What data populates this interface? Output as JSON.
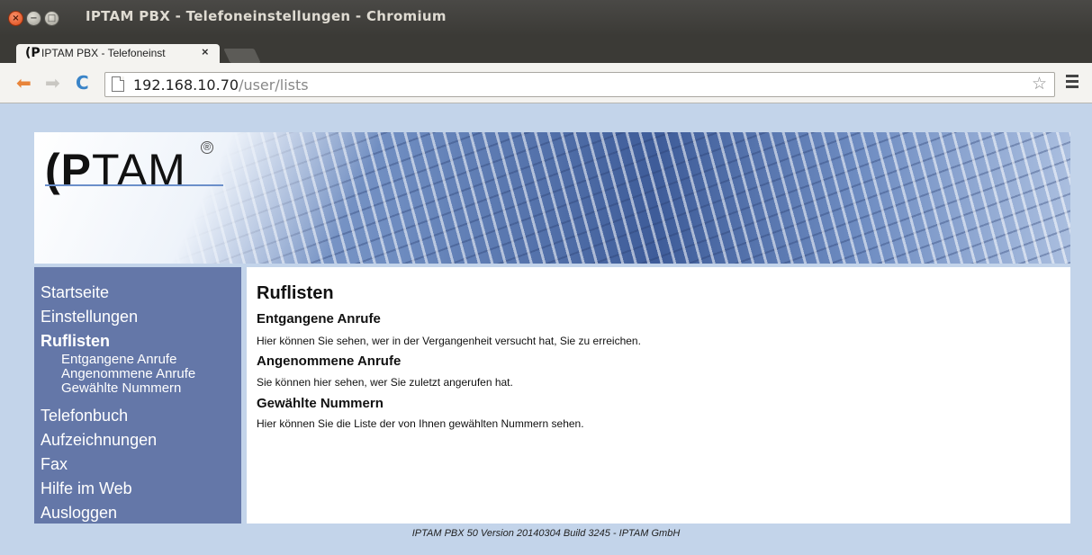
{
  "window": {
    "title": "IPTAM PBX - Telefoneinstellungen - Chromium",
    "close_glyph": "×",
    "min_glyph": "−",
    "max_glyph": "□"
  },
  "tab": {
    "favicon": "(P",
    "label": "IPTAM PBX - Telefoneinst",
    "close_glyph": "×"
  },
  "toolbar": {
    "back_icon": "arrow-left",
    "forward_icon": "arrow-right",
    "reload_icon": "reload",
    "back_glyph": "⬅",
    "forward_glyph": "➡",
    "reload_glyph": "C",
    "url_host": "192.168.10.70",
    "url_path": "/user/lists",
    "star_glyph": "☆"
  },
  "banner": {
    "logo_bold": "(P",
    "logo_light": "TAM",
    "logo_mark": "®"
  },
  "sidebar": {
    "items": [
      {
        "label": "Startseite"
      },
      {
        "label": "Einstellungen"
      },
      {
        "label": "Ruflisten",
        "active": true
      },
      {
        "label": "Telefonbuch"
      },
      {
        "label": "Aufzeichnungen"
      },
      {
        "label": "Fax"
      },
      {
        "label": "Hilfe im Web"
      },
      {
        "label": "Ausloggen"
      }
    ],
    "subitems": [
      {
        "label": "Entgangene Anrufe"
      },
      {
        "label": "Angenommene Anrufe"
      },
      {
        "label": "Gewählte Nummern"
      }
    ]
  },
  "content": {
    "title": "Ruflisten",
    "sections": [
      {
        "heading": "Entgangene Anrufe",
        "text": "Hier können Sie sehen, wer in der Vergangenheit versucht hat, Sie zu erreichen."
      },
      {
        "heading": "Angenommene Anrufe",
        "text": "Sie können hier sehen, wer Sie zuletzt angerufen hat."
      },
      {
        "heading": "Gewählte Nummern",
        "text": "Hier können Sie die Liste der von Ihnen gewählten Nummern sehen."
      }
    ]
  },
  "footer": {
    "text": "IPTAM PBX 50 Version 20140304 Build 3245 - IPTAM GmbH"
  },
  "colors": {
    "page_bg": "#c3d4ea",
    "sidebar_bg": "#6477a8",
    "titlebar_bg": "#3b3a36",
    "close_button": "#de4a17"
  }
}
